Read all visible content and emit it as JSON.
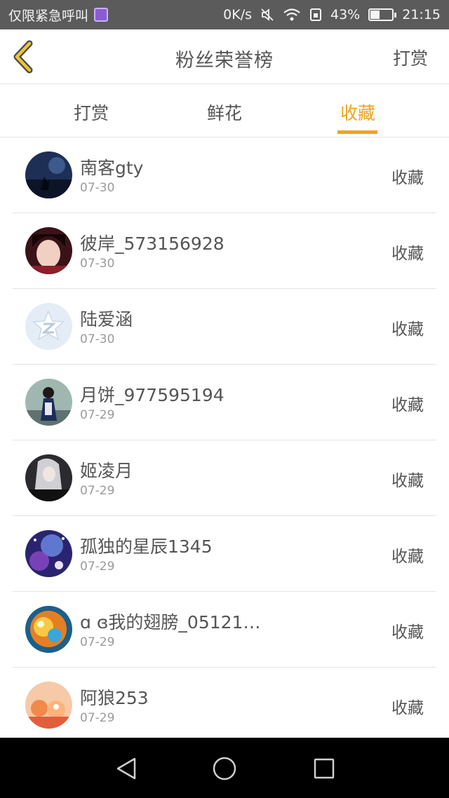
{
  "status_bar": {
    "carrier": "仅限紧急呼叫",
    "speed": "0K/s",
    "battery_percent": "43%",
    "battery_level": 0.43,
    "time": "21:15"
  },
  "header": {
    "title": "粉丝荣誉榜",
    "right_action": "打赏"
  },
  "tabs": [
    {
      "label": "打赏",
      "active": false
    },
    {
      "label": "鲜花",
      "active": false
    },
    {
      "label": "收藏",
      "active": true
    }
  ],
  "accent_color": "#f0a31c",
  "fans": [
    {
      "name": "南客gty",
      "date": "07-30",
      "action": "收藏"
    },
    {
      "name": "彼岸_573156928",
      "date": "07-30",
      "action": "收藏"
    },
    {
      "name": "陆爱涵",
      "date": "07-30",
      "action": "收藏"
    },
    {
      "name": "月饼_977595194",
      "date": "07-29",
      "action": "收藏"
    },
    {
      "name": "姬凌月",
      "date": "07-29",
      "action": "收藏"
    },
    {
      "name": "孤独的星辰1345",
      "date": "07-29",
      "action": "收藏"
    },
    {
      "name": "ɑ ɞ我的翅膀_05121…",
      "date": "07-29",
      "action": "收藏"
    },
    {
      "name": "阿狼253",
      "date": "07-29",
      "action": "收藏"
    }
  ]
}
